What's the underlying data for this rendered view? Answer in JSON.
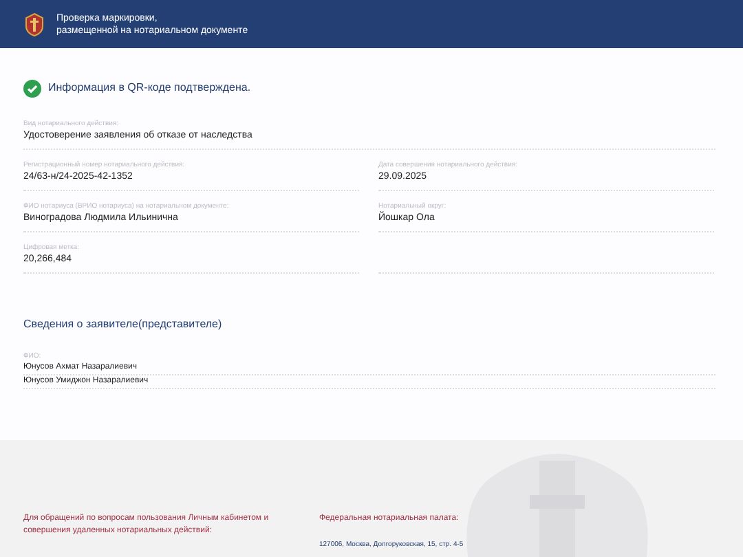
{
  "header": {
    "title_lines": [
      "Проверка маркировки,",
      "размещенной на нотариальном документе"
    ]
  },
  "status": {
    "verified": true,
    "text": "Информация в QR-коде подтверждена."
  },
  "rows": [
    {
      "cells": [
        {
          "label": "Вид нотариального действия:",
          "value": "Удостоверение заявления об отказе от наследства"
        }
      ]
    },
    {
      "cells": [
        {
          "label": "Регистрационный номер нотариального действия:",
          "value": "24/63-н/24-2025-42-1352"
        },
        {
          "label": "Дата совершения нотариального действия:",
          "value": "29.09.2025"
        }
      ]
    },
    {
      "cells": [
        {
          "label": "ФИО нотариуса (ВРИО нотариуса) на нотариальном документе:",
          "value": "Виноградова Людмила Ильинична"
        },
        {
          "label": "Нотариальный округ:",
          "value": "Йошкар Ола"
        }
      ]
    },
    {
      "cells": [
        {
          "label": "Цифровая метка:",
          "value": "20,266,484"
        },
        {}
      ]
    }
  ],
  "applicant": {
    "heading": "Сведения о заявителе(представителе)",
    "label": "ФИО:",
    "names": [
      "Юнусов Ахмат Назаралиевич",
      "Юнусов Умиджон Назаралиевич"
    ]
  },
  "footer": {
    "contact_lines": [
      "Для обращений по вопросам пользования Личным кабинетом и",
      "совершения удаленных нотариальных действий:"
    ],
    "chamber": "Федеральная нотариальная палата:",
    "address": "127006, Москва, Долгоруковская, 15, стр. 4-5"
  }
}
